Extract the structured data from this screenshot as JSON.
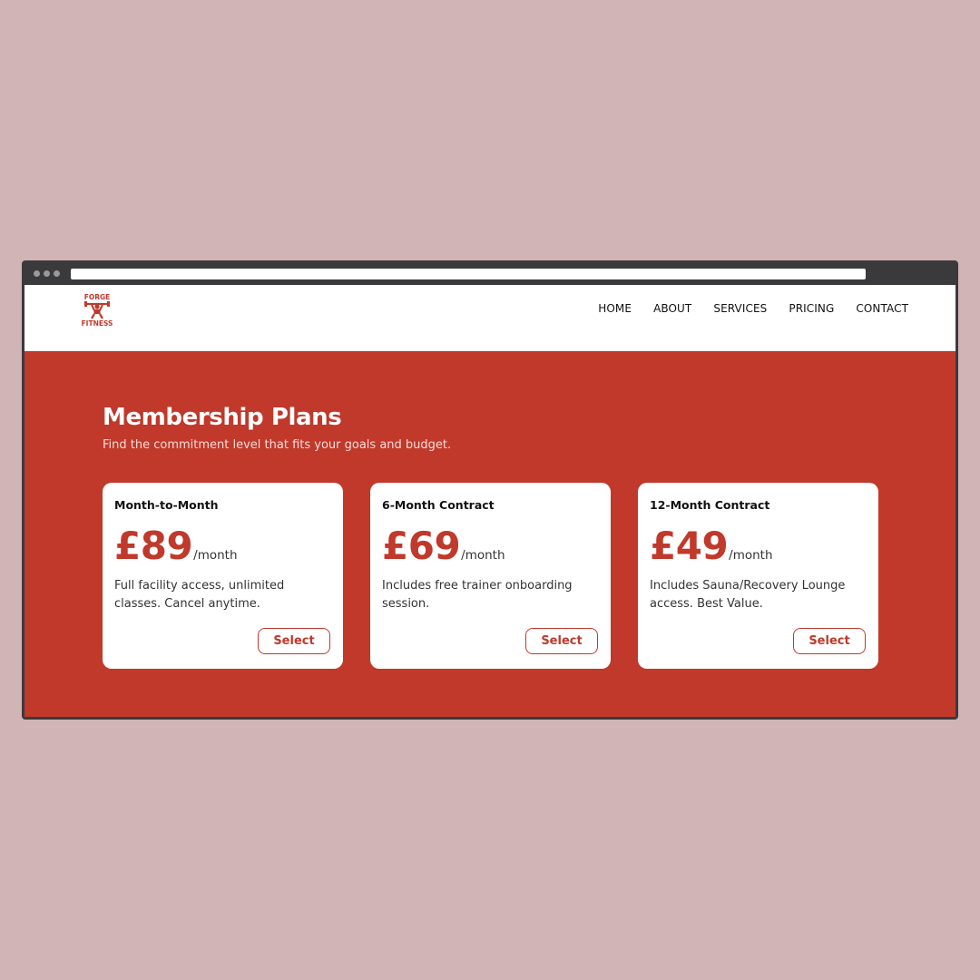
{
  "brand": {
    "logo_top": "FORGE",
    "logo_bottom": "FITNESS",
    "color": "#c0392b"
  },
  "nav": {
    "items": [
      "HOME",
      "ABOUT",
      "SERVICES",
      "PRICING",
      "CONTACT"
    ]
  },
  "hero": {
    "title": "Membership Plans",
    "subtitle": "Find the commitment level that fits your goals and budget.",
    "background": "#c0392b"
  },
  "plans": [
    {
      "name": "Month-to-Month",
      "price": "£89",
      "period": "/month",
      "description": "Full facility access, unlimited classes. Cancel anytime.",
      "button": "Select"
    },
    {
      "name": "6-Month Contract",
      "price": "£69",
      "period": "/month",
      "description": "Includes free trainer onboarding session.",
      "button": "Select"
    },
    {
      "name": "12-Month Contract",
      "price": "£49",
      "period": "/month",
      "description": "Includes Sauna/Recovery Lounge access. Best Value.",
      "button": "Select"
    }
  ]
}
